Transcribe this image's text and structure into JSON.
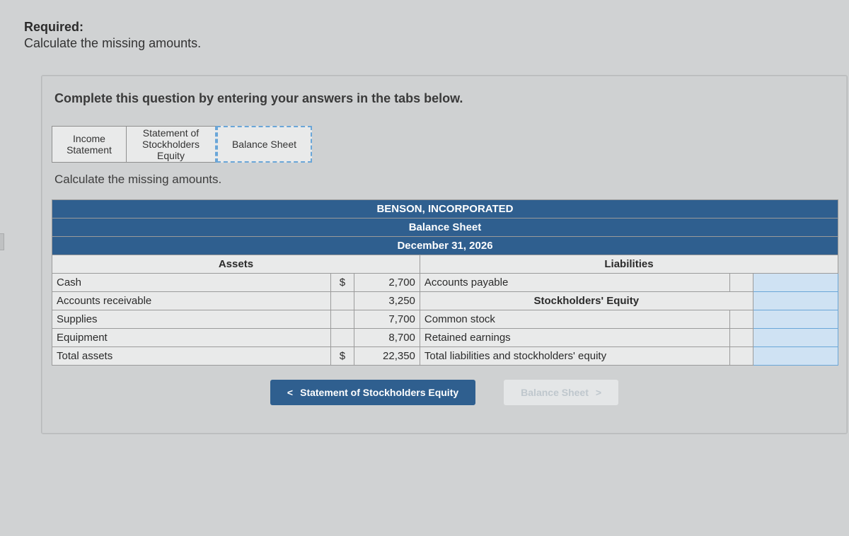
{
  "required": {
    "title": "Required:",
    "sub": "Calculate the missing amounts."
  },
  "prompt": "Complete this question by entering your answers in the tabs below.",
  "tabs": {
    "income": "Income\nStatement",
    "sse": "Statement of\nStockholders\nEquity",
    "balance": "Balance Sheet"
  },
  "sub_instruction": "Calculate the missing amounts.",
  "sheet": {
    "company": "BENSON, INCORPORATED",
    "title": "Balance Sheet",
    "date": "December 31, 2026",
    "left_header": "Assets",
    "right_header": "Liabilities",
    "se_header": "Stockholders' Equity",
    "rows": {
      "cash": {
        "label": "Cash",
        "sym": "$",
        "val": "2,700",
        "rlabel": "Accounts payable"
      },
      "ar": {
        "label": "Accounts receivable",
        "sym": "",
        "val": "3,250",
        "rlabel": ""
      },
      "supplies": {
        "label": "Supplies",
        "sym": "",
        "val": "7,700",
        "rlabel": "Common stock"
      },
      "equipment": {
        "label": "Equipment",
        "sym": "",
        "val": "8,700",
        "rlabel": "Retained earnings"
      },
      "total": {
        "label": "Total assets",
        "sym": "$",
        "val": "22,350",
        "rlabel": "Total liabilities and stockholders' equity"
      }
    }
  },
  "nav": {
    "prev_icon": "<",
    "prev": "Statement of Stockholders Equity",
    "next": "Balance Sheet",
    "next_icon": ">"
  }
}
